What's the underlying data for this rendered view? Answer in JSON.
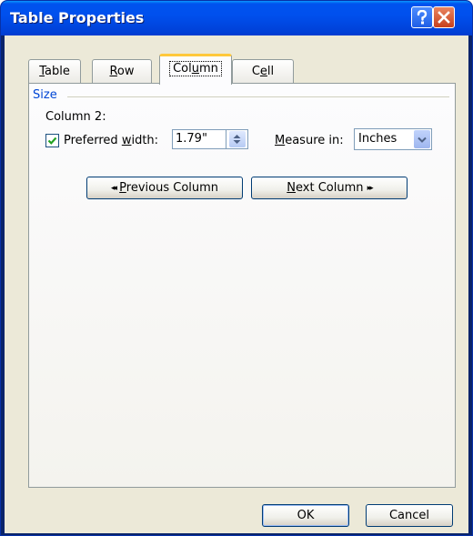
{
  "window": {
    "title": "Table Properties"
  },
  "title_buttons": {
    "help_icon": "help-icon",
    "close_icon": "close-icon"
  },
  "tabs": [
    {
      "id": "table",
      "pre": "",
      "key": "T",
      "post": "able"
    },
    {
      "id": "row",
      "pre": "",
      "key": "R",
      "post": "ow"
    },
    {
      "id": "column",
      "pre": "Col",
      "key": "u",
      "post": "mn",
      "selected": true
    },
    {
      "id": "cell",
      "pre": "C",
      "key": "e",
      "post": "ll"
    }
  ],
  "size_group": {
    "label": "Size",
    "column_label": "Column 2:",
    "preferred_width": {
      "checked": true,
      "label_pre": "Preferred ",
      "label_key": "w",
      "label_post": "idth:",
      "value": "1.79\""
    },
    "measure_in": {
      "label_key": "M",
      "label_post": "easure in:",
      "value": "Inches"
    }
  },
  "nav_buttons": {
    "previous": {
      "arrows": "◂◂",
      "key": "P",
      "post": "revious Column"
    },
    "next": {
      "key": "N",
      "post": "ext Column",
      "arrows": "▸▸"
    }
  },
  "footer": {
    "ok_label": "OK",
    "cancel_label": "Cancel"
  },
  "colors": {
    "title_bar": "#0050ee",
    "dialog_bg": "#ece9d8",
    "group_label": "#0046d5",
    "selected_tab_accent": "#ffc83c",
    "check_mark": "#21a121"
  }
}
